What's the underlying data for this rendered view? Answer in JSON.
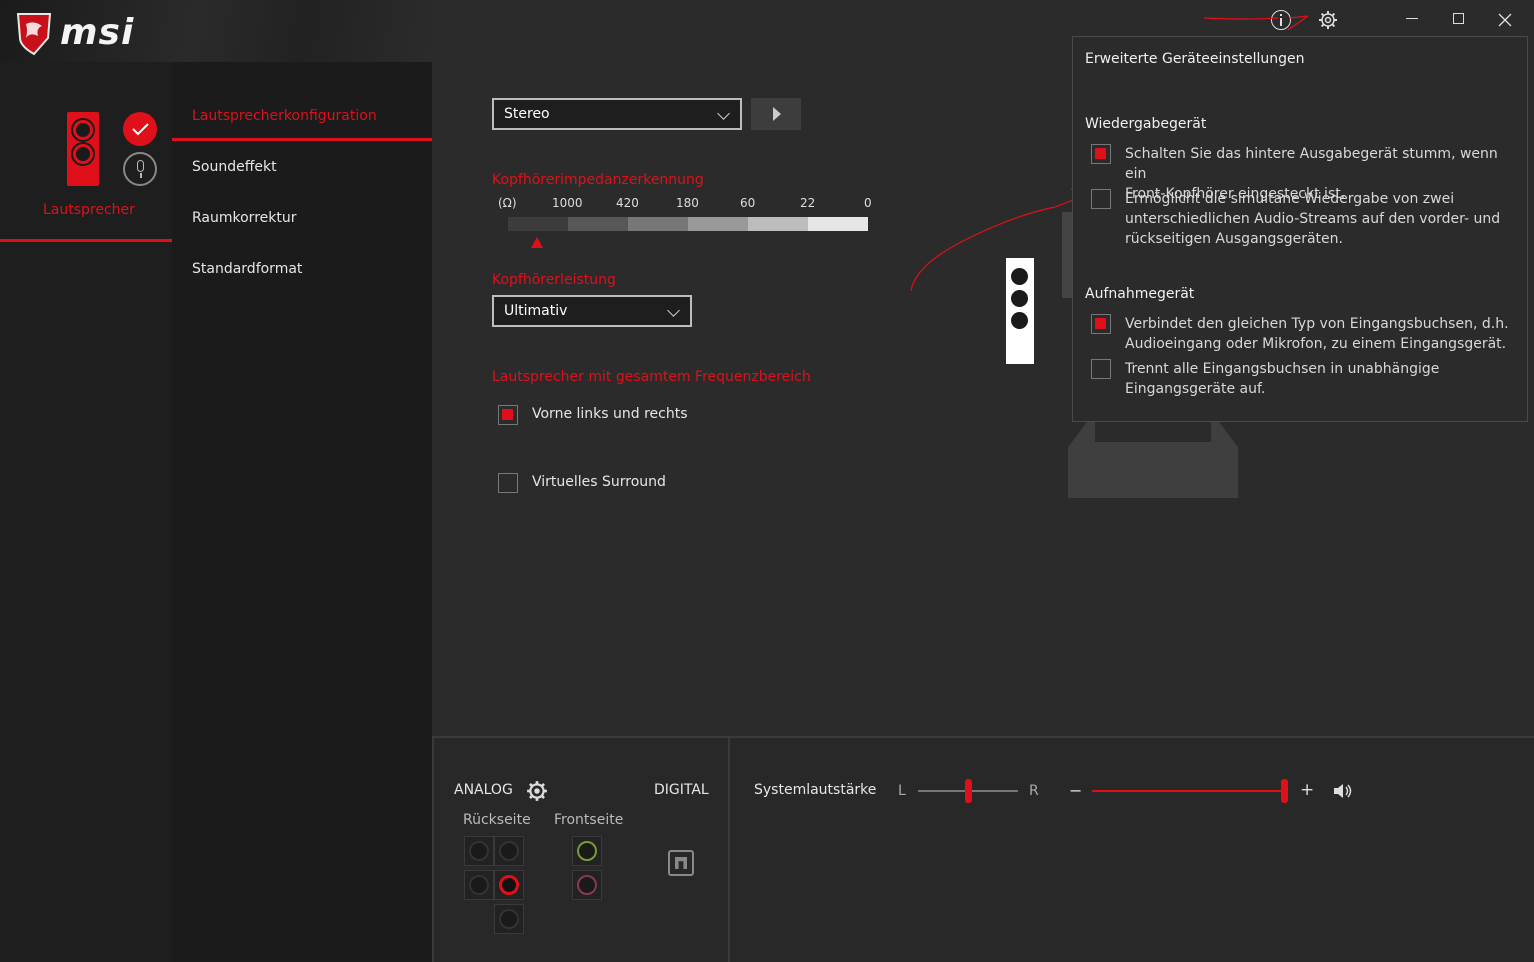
{
  "brand": {
    "logo_text": "msi"
  },
  "device": {
    "label": "Lautsprecher",
    "accent": "#e0101a"
  },
  "nav": {
    "items": [
      {
        "label": "Lautsprecherkonfiguration",
        "active": true
      },
      {
        "label": "Soundeffekt",
        "active": false
      },
      {
        "label": "Raumkorrektur",
        "active": false
      },
      {
        "label": "Standardformat",
        "active": false
      }
    ]
  },
  "config": {
    "speaker_mode": "Stereo",
    "impedance": {
      "title": "Kopfhörerimpedanzerkennung",
      "unit": "(Ω)",
      "ticks": [
        "1000",
        "420",
        "180",
        "60",
        "22",
        "0"
      ],
      "level": 0.08
    },
    "power": {
      "title": "Kopfhörerleistung",
      "value": "Ultimativ"
    },
    "fullrange": {
      "title": "Lautsprecher mit gesamtem Frequenzbereich",
      "front_label": "Vorne links und rechts",
      "front_checked": true
    },
    "surround": {
      "label": "Virtuelles Surround",
      "checked": false
    }
  },
  "popup": {
    "title": "Erweiterte Geräteeinstellungen",
    "playback": {
      "header": "Wiedergabegerät",
      "options": [
        {
          "line1": "Schalten Sie das hintere Ausgabegerät stumm, wenn ein",
          "line2": "Front-Kopfhörer eingesteckt ist.",
          "line3": "",
          "checked": true
        },
        {
          "line1": "Ermöglicht die simultane Wiedergabe von zwei",
          "line2": "unterschiedlichen Audio-Streams auf den vorder- und",
          "line3": "rückseitigen Ausgangsgeräten.",
          "checked": false
        }
      ]
    },
    "recording": {
      "header": "Aufnahmegerät",
      "options": [
        {
          "line1": "Verbindet den gleichen Typ von Eingangsbuchsen, d.h.",
          "line2": "Audioeingang oder Mikrofon, zu einem Eingangsgerät.",
          "checked": true
        },
        {
          "line1": "Trennt alle Eingangsbuchsen in unabhängige",
          "line2": "Eingangsgeräte auf.",
          "checked": false
        }
      ]
    }
  },
  "bottom": {
    "analog_label": "ANALOG",
    "digital_label": "DIGITAL",
    "rear_label": "Rückseite",
    "front_label": "Frontseite",
    "system_volume_label": "Systemlautstärke",
    "balance_left": "L",
    "balance_right": "R",
    "minus": "−",
    "plus": "+",
    "balance": 0.5,
    "volume": 1.0
  }
}
